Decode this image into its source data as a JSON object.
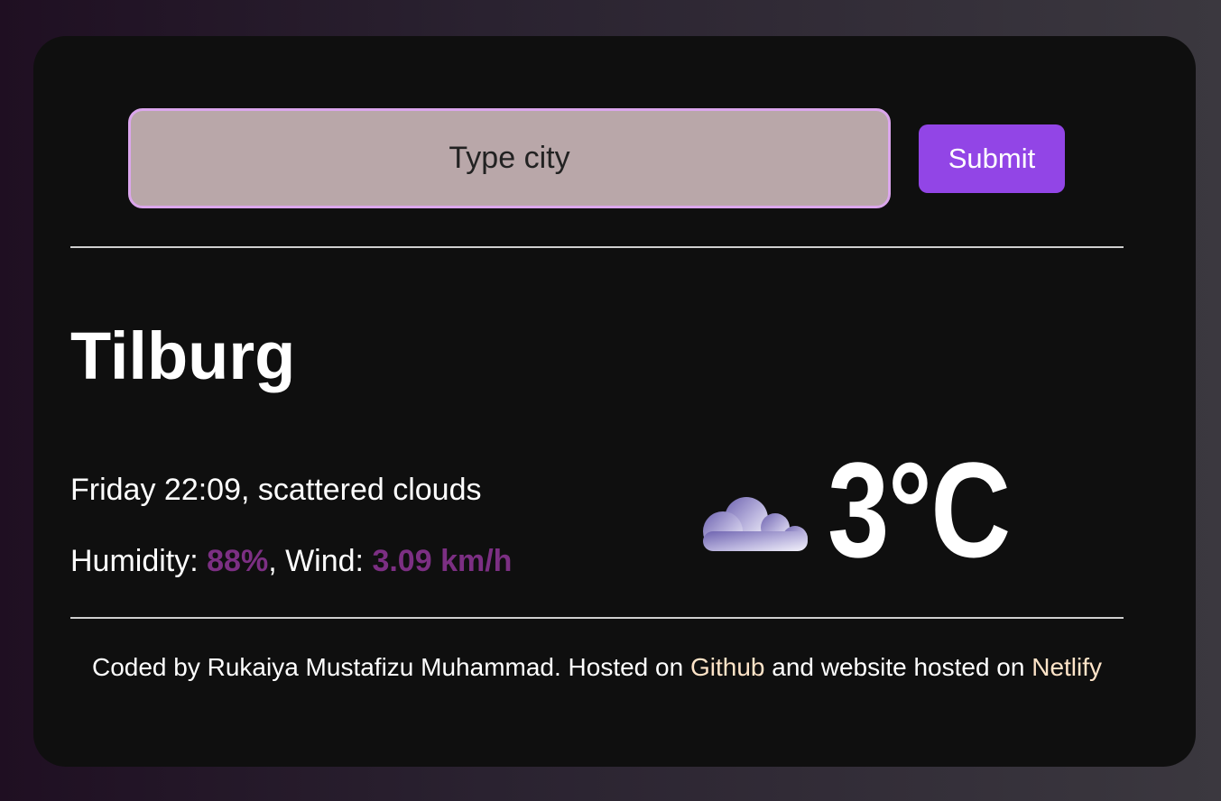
{
  "search": {
    "placeholder": "Type city",
    "submit_label": "Submit"
  },
  "weather": {
    "city": "Tilburg",
    "day_time": "Friday 22:09",
    "description": "scattered clouds",
    "humidity_label": "Humidity: ",
    "humidity_value": "88%",
    "wind_label": ", Wind: ",
    "wind_value": "3.09 km/h",
    "temperature": "3°C",
    "icon": "scattered-clouds-icon"
  },
  "footer": {
    "text_before": "Coded by Rukaiya Mustafizu Muhammad. Hosted on ",
    "github_link": "Github",
    "text_middle": " and website hosted on ",
    "netlify_link": "Netlify"
  },
  "colors": {
    "accent_purple": "#9245e6",
    "value_purple": "#7c2f83",
    "input_bg": "#b9a7a9",
    "input_border": "#dba6ec",
    "link_color": "#ffe4c8"
  }
}
